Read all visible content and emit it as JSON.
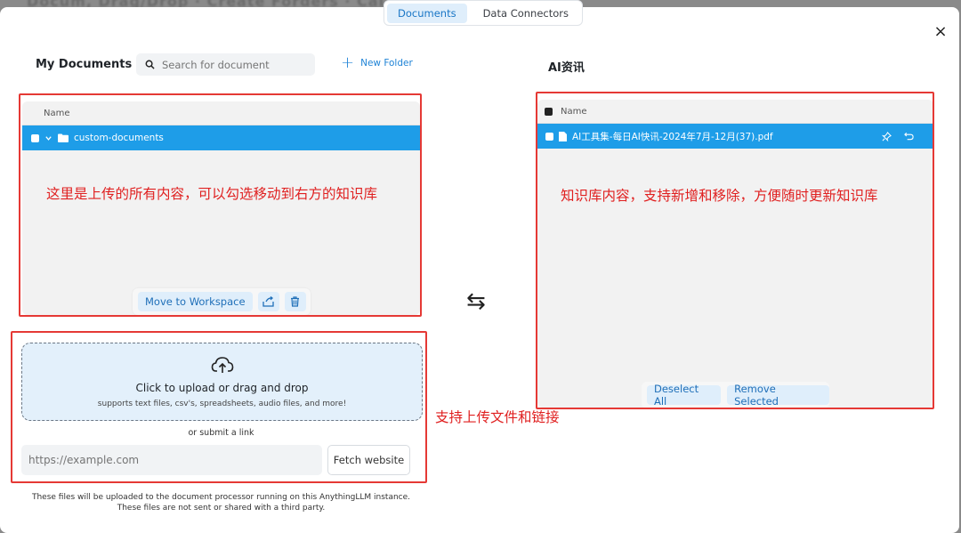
{
  "backdrop": {
    "text": "Docum, Drag/Drop · Create Forders · Cal Subnis"
  },
  "tabs": [
    {
      "label": "Documents",
      "active": true
    },
    {
      "label": "Data Connectors",
      "active": false
    }
  ],
  "close_symbol": "×",
  "left": {
    "title": "My Documents",
    "search_placeholder": "Search for document",
    "new_folder_label": "New Folder",
    "column_name": "Name",
    "folder_name": "custom-documents",
    "annotation": "这里是上传的所有内容，可以勾选移动到右方的知识库",
    "move_button": "Move to Workspace"
  },
  "right": {
    "title": "AI资讯",
    "column_name": "Name",
    "file_name": "AI工具集-每日AI快讯-2024年7月-12月(37).pdf",
    "annotation": "知识库内容，支持新增和移除，方便随时更新知识库",
    "deselect_button": "Deselect All",
    "remove_button": "Remove Selected"
  },
  "swap_symbol": "⇆",
  "upload": {
    "main_text": "Click to upload or drag and drop",
    "sub_text": "supports text files, csv's, spreadsheets, audio files, and more!",
    "or_link": "or submit a link",
    "url_placeholder": "https://example.com",
    "fetch_button": "Fetch website",
    "annotation": "支持上传文件和链接",
    "note_line1": "These files will be uploaded to the document processor running on this AnythingLLM instance.",
    "note_line2": "These files are not sent or shared with a third party."
  },
  "colors": {
    "accent": "#1e9de8",
    "annotation": "#e02020",
    "button_bg": "#dfeefb"
  }
}
